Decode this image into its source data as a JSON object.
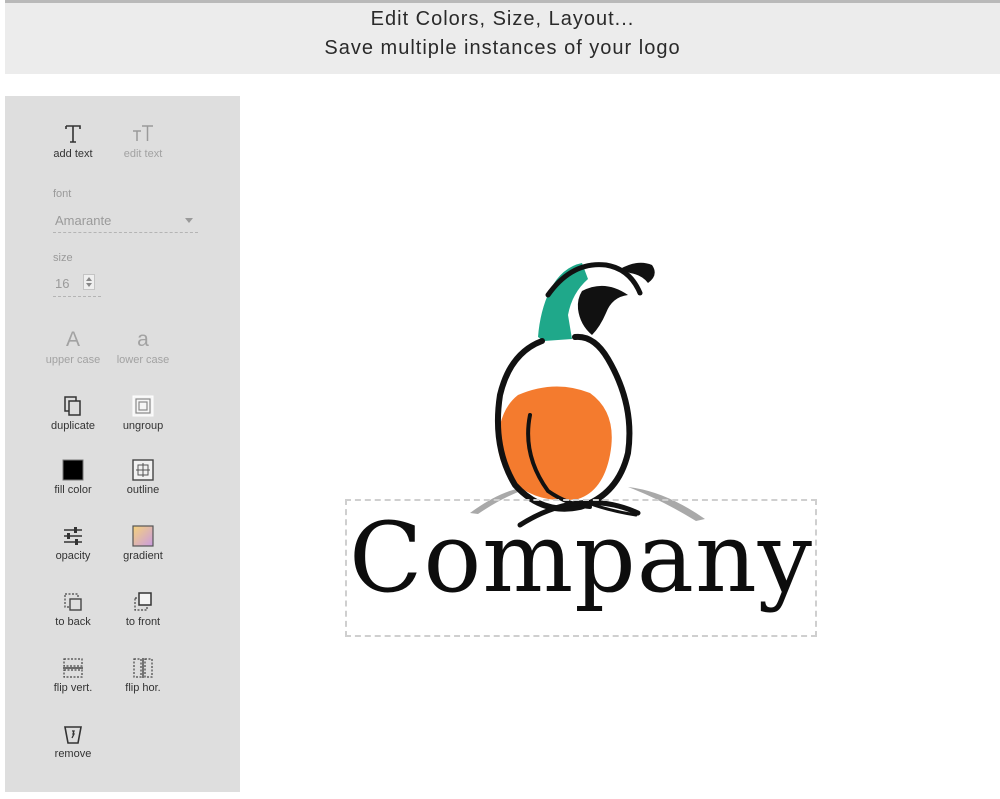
{
  "banner": {
    "line1": "Edit Colors, Size, Layout...",
    "line2": "Save multiple instances of your logo"
  },
  "sidebar": {
    "add_text": "add text",
    "edit_text": "edit text",
    "font_label": "font",
    "font_value": "Amarante",
    "size_label": "size",
    "size_value": "16",
    "upper_case": "upper case",
    "upper_case_glyph": "A",
    "lower_case": "lower case",
    "lower_case_glyph": "a",
    "duplicate": "duplicate",
    "ungroup": "ungroup",
    "fill_color": "fill color",
    "outline": "outline",
    "opacity": "opacity",
    "gradient": "gradient",
    "to_back": "to back",
    "to_front": "to front",
    "flip_vert": "flip vert.",
    "flip_hor": "flip hor.",
    "remove": "remove"
  },
  "logo": {
    "text": "Company",
    "colors": {
      "head": "#1fa88a",
      "body": "#f47b2e",
      "shadow": "#a9a9a9",
      "ink": "#111111"
    }
  },
  "icons": {
    "add_text": "text-icon",
    "edit_text": "text-size-icon",
    "duplicate": "copy-icon",
    "ungroup": "ungroup-icon",
    "fill_color": "fill-color-swatch-icon",
    "outline": "outline-icon",
    "opacity": "sliders-icon",
    "gradient": "gradient-swatch-icon",
    "to_back": "send-back-icon",
    "to_front": "bring-front-icon",
    "flip_vert": "flip-vertical-icon",
    "flip_hor": "flip-horizontal-icon",
    "remove": "trash-icon"
  }
}
